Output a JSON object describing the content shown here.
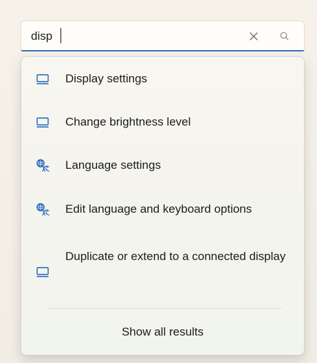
{
  "search": {
    "value": "disp",
    "clear_icon": "close-icon",
    "search_icon": "search-icon"
  },
  "results": [
    {
      "label": "Display settings",
      "icon": "monitor-icon"
    },
    {
      "label": "Change brightness level",
      "icon": "monitor-icon"
    },
    {
      "label": "Language settings",
      "icon": "language-icon"
    },
    {
      "label": "Edit language and keyboard options",
      "icon": "language-icon"
    },
    {
      "label": "Duplicate or extend to a connected display",
      "icon": "monitor-icon"
    }
  ],
  "footer": {
    "show_all_label": "Show all results"
  },
  "colors": {
    "accent": "#2f6fbf",
    "background": "#f3eee6",
    "text": "#1b1b1b"
  }
}
